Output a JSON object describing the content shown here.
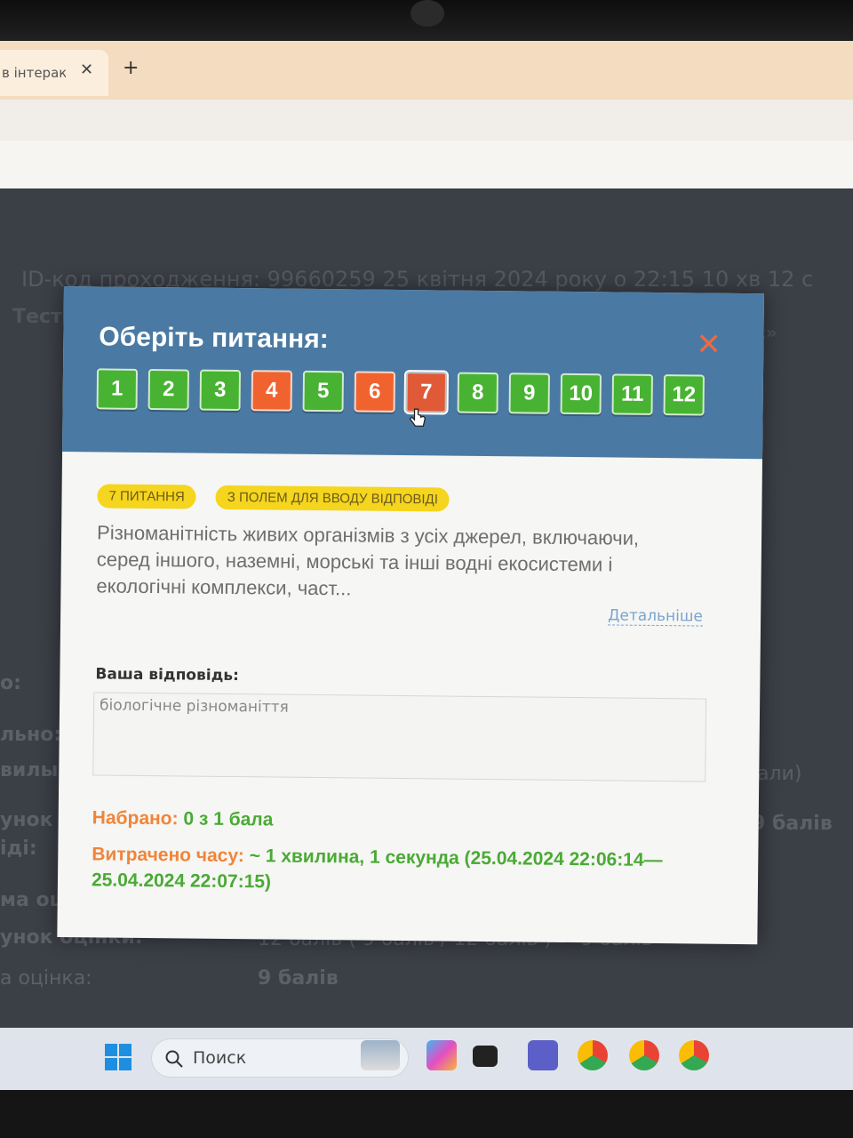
{
  "browser": {
    "tab_title": "в інтерак",
    "tab_close": "✕",
    "new_tab": "+"
  },
  "background": {
    "id_line": "ID-код проходження: 99660259    25 квітня 2024 року о 22:15 10 хв 12 с",
    "test_label": "Тест",
    "right_fragment": "с»",
    "left_labels": [
      "о:",
      "льно:",
      "вилы",
      "унок",
      "іді:",
      "ма оц",
      "унок оцінки:",
      "а оцінка:"
    ],
    "right_1": "али)",
    "right_2": "9 балів",
    "row_mid": "12 балів   ( 9 балів / 12 балів ) = 9 балів",
    "final_value": "9 балів"
  },
  "modal": {
    "title": "Оберіть питання:",
    "close": "✕",
    "questions": [
      {
        "label": "1",
        "status": "ok"
      },
      {
        "label": "2",
        "status": "ok"
      },
      {
        "label": "3",
        "status": "ok"
      },
      {
        "label": "4",
        "status": "bad"
      },
      {
        "label": "5",
        "status": "ok"
      },
      {
        "label": "6",
        "status": "bad"
      },
      {
        "label": "7",
        "status": "active"
      },
      {
        "label": "8",
        "status": "ok"
      },
      {
        "label": "9",
        "status": "ok"
      },
      {
        "label": "10",
        "status": "ok"
      },
      {
        "label": "11",
        "status": "ok"
      },
      {
        "label": "12",
        "status": "ok"
      }
    ],
    "badge_number": "7 ПИТАННЯ",
    "badge_type": "З ПОЛЕМ ДЛЯ ВВОДУ ВІДПОВІДІ",
    "question_text": "Різноманітність живих організмів з усіх джерел, включаючи, серед іншого, наземні, морські та інші водні екосистеми і екологічні комплекси, част...",
    "more_link": "Детальніше",
    "answer_label": "Ваша відповідь:",
    "answer_value": "біологічне різноманіття",
    "score_label": "Набрано:",
    "score_value": "0 з 1 бала",
    "time_label": "Витрачено часу:",
    "time_value": "~ 1 хвилина, 1 секунда (25.04.2024 22:06:14—25.04.2024 22:07:15)"
  },
  "taskbar": {
    "search_placeholder": "Поиск",
    "icons": [
      "windows-start-icon",
      "search-icon",
      "penguin-widget-icon",
      "copilot-icon",
      "file-explorer-icon",
      "teams-icon",
      "chrome-profile-icon",
      "chrome-profile-icon",
      "chrome-icon"
    ]
  },
  "colors": {
    "header_blue": "#4a7aa3",
    "correct_green": "#48b332",
    "wrong_orange": "#f0632f",
    "badge_yellow": "#f5d51d",
    "label_orange": "#f0853a",
    "value_green": "#4aaa35"
  }
}
